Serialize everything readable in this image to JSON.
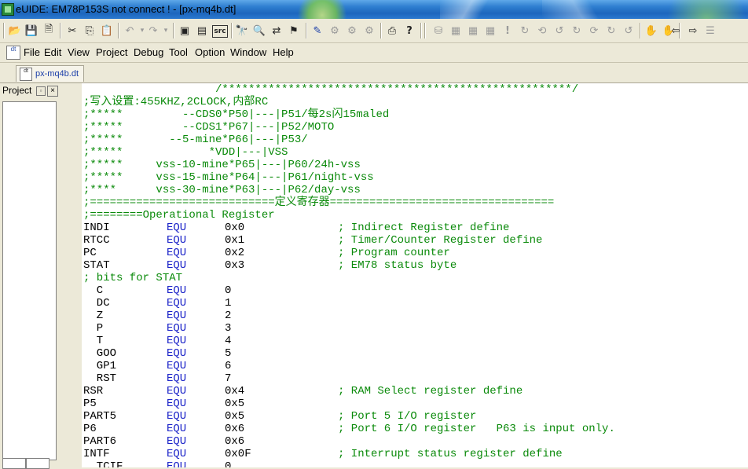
{
  "window": {
    "title": "eUIDE: EM78P153S not connect ! - [px-mq4b.dt]"
  },
  "toolbar": {
    "icons": [
      "open-folder-icon",
      "save-icon",
      "save-all-icon",
      "cut-icon",
      "copy-icon",
      "paste-icon",
      "undo-icon",
      "redo-icon",
      "window-icon",
      "view-icon",
      "src-icon",
      "find-icon",
      "find-next-icon",
      "replace-icon",
      "bookmark-icon",
      "compile-icon",
      "build-icon",
      "rebuild-icon",
      "link-icon",
      "print-icon",
      "help-icon",
      "debug-icons"
    ],
    "src_label": "src"
  },
  "menu": {
    "items": [
      {
        "label": "File"
      },
      {
        "label": "Edit"
      },
      {
        "label": "View"
      },
      {
        "label": "Project"
      },
      {
        "label": "Debug"
      },
      {
        "label": "Tool"
      },
      {
        "label": "Option"
      },
      {
        "label": "Window"
      },
      {
        "label": "Help"
      }
    ]
  },
  "document_tab": {
    "label": "px-mq4b.dt",
    "icon_text": "dt"
  },
  "project_pane": {
    "title": "Project",
    "close_glyph": "×",
    "pin_glyph": "▫"
  },
  "code": {
    "lines": [
      {
        "kind": "comment",
        "text": "                    /*****************************************************/"
      },
      {
        "kind": "comment",
        "text": ";写入设置:455KHZ,2CLOCK,内部RC"
      },
      {
        "kind": "comment",
        "text": ";*****         --CDS0*P50|---|P51/每2s闪15maled"
      },
      {
        "kind": "comment",
        "text": ";*****         --CDS1*P67|---|P52/MOTO"
      },
      {
        "kind": "comment",
        "text": ";*****       --5-mine*P66|---|P53/"
      },
      {
        "kind": "comment",
        "text": ";*****             *VDD|---|VSS"
      },
      {
        "kind": "comment",
        "text": ";*****     vss-10-mine*P65|---|P60/24h-vss"
      },
      {
        "kind": "comment",
        "text": ";*****     vss-15-mine*P64|---|P61/night-vss"
      },
      {
        "kind": "comment",
        "text": ";****      vss-30-mine*P63|---|P62/day-vss"
      },
      {
        "kind": "comment",
        "text": ";============================定义寄存器=================================="
      },
      {
        "kind": "comment",
        "text": ";========Operational Register"
      },
      {
        "kind": "equ",
        "name": "INDI",
        "op": "EQU",
        "value": "0x0",
        "comment": "; Indirect Register define"
      },
      {
        "kind": "equ",
        "name": "RTCC",
        "op": "EQU",
        "value": "0x1",
        "comment": "; Timer/Counter Register define"
      },
      {
        "kind": "equ",
        "name": "PC",
        "op": "EQU",
        "value": "0x2",
        "comment": "; Program counter"
      },
      {
        "kind": "equ",
        "name": "STAT",
        "op": "EQU",
        "value": "0x3",
        "comment": "; EM78 status byte"
      },
      {
        "kind": "comment",
        "text": "; bits for STAT"
      },
      {
        "kind": "equ",
        "name": "  C",
        "op": "EQU",
        "value": "0",
        "comment": ""
      },
      {
        "kind": "equ",
        "name": "  DC",
        "op": "EQU",
        "value": "1",
        "comment": ""
      },
      {
        "kind": "equ",
        "name": "  Z",
        "op": "EQU",
        "value": "2",
        "comment": ""
      },
      {
        "kind": "equ",
        "name": "  P",
        "op": "EQU",
        "value": "3",
        "comment": ""
      },
      {
        "kind": "equ",
        "name": "  T",
        "op": "EQU",
        "value": "4",
        "comment": ""
      },
      {
        "kind": "equ",
        "name": "  GOO",
        "op": "EQU",
        "value": "5",
        "comment": ""
      },
      {
        "kind": "equ",
        "name": "  GP1",
        "op": "EQU",
        "value": "6",
        "comment": ""
      },
      {
        "kind": "equ",
        "name": "  RST",
        "op": "EQU",
        "value": "7",
        "comment": ""
      },
      {
        "kind": "equ",
        "name": "RSR",
        "op": "EQU",
        "value": "0x4",
        "comment": "; RAM Select register define"
      },
      {
        "kind": "equ",
        "name": "P5",
        "op": "EQU",
        "value": "0x5",
        "comment": ""
      },
      {
        "kind": "equ",
        "name": "PART5",
        "op": "EQU",
        "value": "0x5",
        "comment": "; Port 5 I/O register"
      },
      {
        "kind": "equ",
        "name": "P6",
        "op": "EQU",
        "value": "0x6",
        "comment": "; Port 6 I/O register   P63 is input only."
      },
      {
        "kind": "equ",
        "name": "PART6",
        "op": "EQU",
        "value": "0x6",
        "comment": ""
      },
      {
        "kind": "equ",
        "name": "INTF",
        "op": "EQU",
        "value": "0x0F",
        "comment": "; Interrupt status register define"
      },
      {
        "kind": "equ",
        "name": "  TCIF",
        "op": "EQU",
        "value": "0",
        "comment": ""
      }
    ]
  },
  "colors": {
    "comment": "#0a8a0a",
    "keyword": "#1a22c8",
    "text": "#000000"
  }
}
